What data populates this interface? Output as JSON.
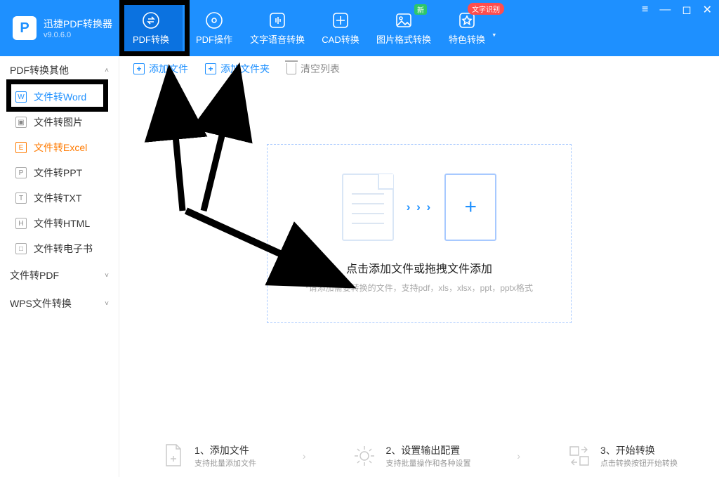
{
  "brand": {
    "name": "迅捷PDF转换器",
    "version": "v9.0.6.0"
  },
  "header": {
    "tabs": [
      {
        "label": "PDF转换"
      },
      {
        "label": "PDF操作"
      },
      {
        "label": "文字语音转换"
      },
      {
        "label": "CAD转换"
      },
      {
        "label": "图片格式转换",
        "badge_new": "新"
      },
      {
        "label": "特色转换",
        "badge_ocr": "文字识别"
      }
    ]
  },
  "toolbar": {
    "add_file": "添加文件",
    "add_folder": "添加文件夹",
    "clear_list": "清空列表"
  },
  "sidebar": {
    "groups": [
      {
        "title": "PDF转换其他",
        "expanded": true
      },
      {
        "title": "文件转PDF",
        "expanded": false
      },
      {
        "title": "WPS文件转换",
        "expanded": false
      }
    ],
    "items": [
      {
        "label": "文件转Word",
        "glyph": "W"
      },
      {
        "label": "文件转图片",
        "glyph": "▣"
      },
      {
        "label": "文件转Excel",
        "glyph": "E"
      },
      {
        "label": "文件转PPT",
        "glyph": "P"
      },
      {
        "label": "文件转TXT",
        "glyph": "T"
      },
      {
        "label": "文件转HTML",
        "glyph": "H"
      },
      {
        "label": "文件转电子书",
        "glyph": "□"
      }
    ]
  },
  "dropzone": {
    "title": "点击添加文件或拖拽文件添加",
    "subtitle": "*请添加需要转换的文件，支持pdf，xls，xlsx，ppt，pptx格式"
  },
  "steps": [
    {
      "title": "1、添加文件",
      "sub": "支持批量添加文件"
    },
    {
      "title": "2、设置输出配置",
      "sub": "支持批量操作和各种设置"
    },
    {
      "title": "3、开始转换",
      "sub": "点击转换按钮开始转换"
    }
  ]
}
